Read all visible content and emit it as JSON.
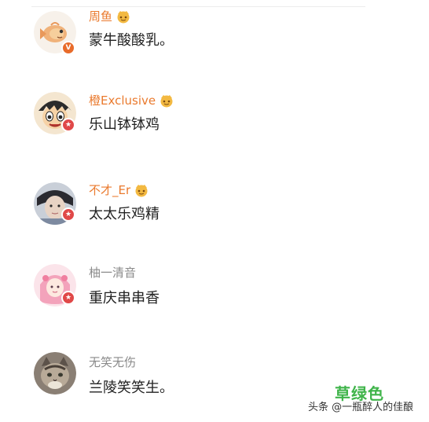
{
  "comments": [
    {
      "username": "周鱼",
      "username_style": "vip",
      "vip_icon": "vip-crown-icon",
      "text": "蒙牛酸酸乳。",
      "avatar": "fish-cartoon-avatar",
      "badge_icon": "verified-v-icon",
      "badge_color": "#e86b2a",
      "badge_glyph": "V"
    },
    {
      "username": "橙Exclusive",
      "username_style": "vip",
      "vip_icon": "vip-crown-icon",
      "text": "乐山钵钵鸡",
      "avatar": "anime-boy-avatar",
      "badge_icon": "star-badge-icon",
      "badge_color": "#e04848",
      "badge_glyph": "★"
    },
    {
      "username": "不才_Er",
      "username_style": "vip",
      "vip_icon": "vip-crown-icon",
      "text": "太太乐鸡精",
      "avatar": "photo-person-avatar",
      "badge_icon": "star-badge-icon",
      "badge_color": "#e04848",
      "badge_glyph": "★"
    },
    {
      "username": "柚一清音",
      "username_style": "plain",
      "vip_icon": "",
      "text": "重庆串串香",
      "avatar": "pink-girl-avatar",
      "badge_icon": "star-badge-icon",
      "badge_color": "#e04848",
      "badge_glyph": "★"
    },
    {
      "username": "无笑无伤",
      "username_style": "plain",
      "vip_icon": "",
      "text": "兰陵笑笑生。",
      "avatar": "cat-photo-avatar",
      "badge_icon": "",
      "badge_color": "",
      "badge_glyph": ""
    }
  ],
  "watermark": {
    "green_text": "草绿色",
    "credit_text": "头条 @一瓶醉人的佳酿",
    "green_color": "#3fb44a"
  },
  "colors": {
    "vip_name": "#ea7a2e",
    "plain_name": "#8a8a8a",
    "comment_text": "#222222"
  }
}
